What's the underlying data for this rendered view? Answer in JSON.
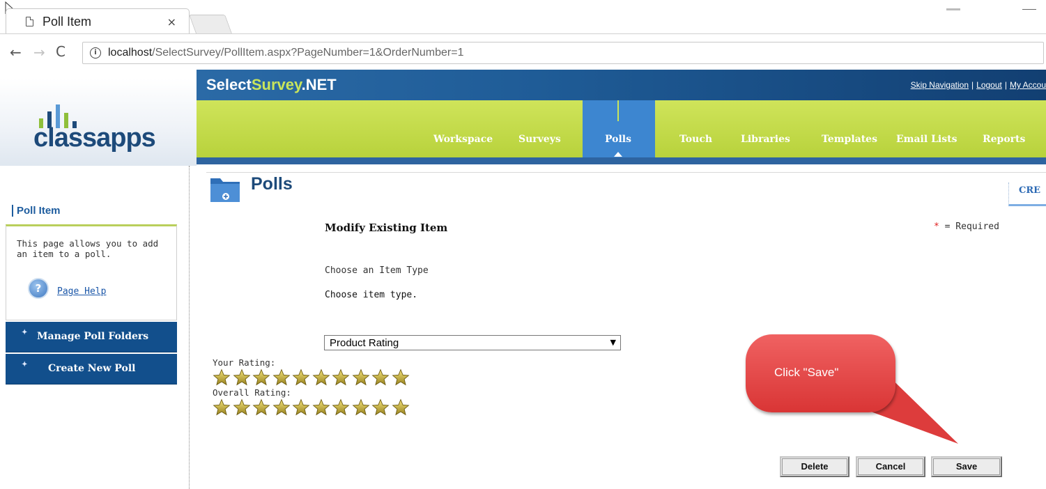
{
  "browser": {
    "tab_title": "Poll Item",
    "tab_close": "×",
    "url_host": "localhost",
    "url_path": "/SelectSurvey/PollItem.aspx?PageNumber=1&OrderNumber=1",
    "info_glyph": "i",
    "back_glyph": "←",
    "forward_glyph": "→",
    "reload_glyph": "C"
  },
  "header": {
    "logo_text": "classapps",
    "brand_main_1": "Select",
    "brand_accent": "Survey",
    "brand_main_2": ".NET",
    "links": [
      "Skip Navigation",
      "Logout",
      "My Accou"
    ],
    "link_separator": "|",
    "nav": [
      "Workspace",
      "Surveys",
      "Polls",
      "Touch",
      "Libraries",
      "Templates",
      "Email Lists",
      "Reports"
    ],
    "active_nav": "Polls"
  },
  "sidebar": {
    "title": "Poll Item",
    "description": "This page allows you to add an item to a poll.",
    "help_glyph": "?",
    "help_link": "Page Help",
    "buttons": [
      "Manage Poll Folders",
      "Create New Poll"
    ],
    "button_bullet": "✦"
  },
  "main": {
    "page_title": "Polls",
    "side_tab": "CRE",
    "section_title": "Modify Existing Item",
    "required_star": "*",
    "required_text": " = Required",
    "choose_header": "Choose an Item Type",
    "choose_desc": "Choose item type.",
    "item_type_selected": "Product Rating",
    "select_arrow": "▼",
    "your_rating_label": "Your Rating:",
    "overall_rating_label": "Overall Rating:",
    "your_rating_stars": 10,
    "overall_rating_stars": 10,
    "buttons": {
      "delete": "Delete",
      "cancel": "Cancel",
      "save": "Save"
    }
  },
  "callout": {
    "text": "Click \"Save\"",
    "color": "#e84848"
  },
  "colors": {
    "brand_blue": "#1f5c97",
    "nav_green": "#c4db4a",
    "nav_active": "#3d86d0",
    "sidebar_button": "#124f8c",
    "title_blue": "#1d4a7a"
  }
}
